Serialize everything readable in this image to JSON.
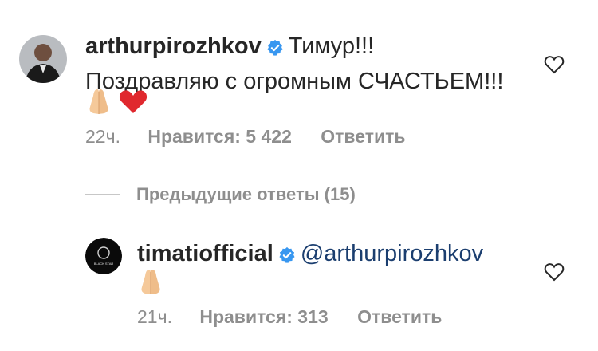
{
  "comment1": {
    "username": "arthurpirozhkov",
    "text_line1": "Тимур!!!",
    "text_line2": "Поздравляю с огромным СЧАСТЬЕМ!!!",
    "emojis": [
      "folded-hands",
      "red-heart"
    ],
    "time": "22ч.",
    "likes": "Нравится: 5 422",
    "reply_label": "Ответить"
  },
  "view_replies": {
    "label": "Предыдущие ответы (15)"
  },
  "comment2": {
    "username": "timatiofficial",
    "mention": "@arthurpirozhkov",
    "emojis": [
      "folded-hands"
    ],
    "avatar_text": "BLACK STAR",
    "time": "21ч.",
    "likes": "Нравится: 313",
    "reply_label": "Ответить"
  },
  "colors": {
    "text": "#262626",
    "meta": "#8e8e8e",
    "mention": "#1b3e6f",
    "verified": "#3897f0"
  }
}
